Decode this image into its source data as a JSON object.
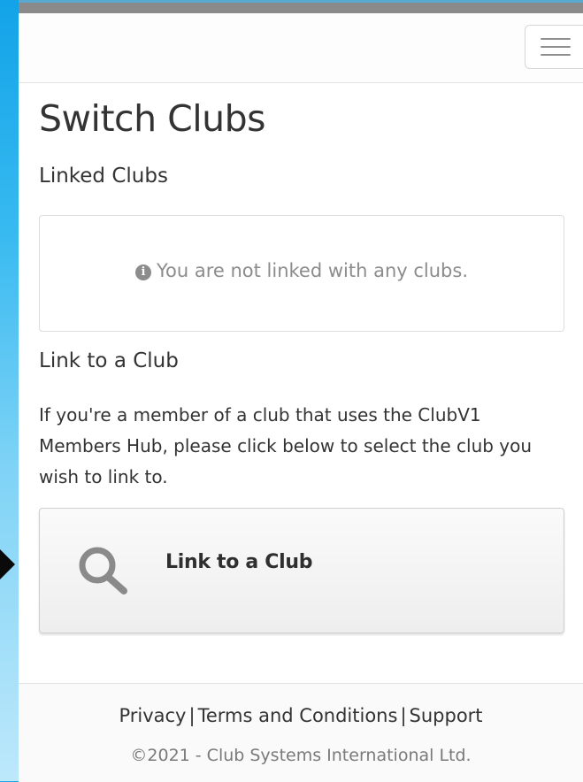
{
  "header": {
    "menu_icon": "hamburger-menu-icon"
  },
  "page": {
    "title": "Switch Clubs"
  },
  "linked_clubs": {
    "heading": "Linked Clubs",
    "empty_icon": "info-circle-icon",
    "empty_message": "You are not linked with any clubs."
  },
  "link_section": {
    "heading": "Link to a Club",
    "description": "If you're a member of a club that uses the ClubV1 Members Hub, please click below to select the club you wish to link to.",
    "button_icon": "search-icon",
    "button_label": "Link to a Club"
  },
  "footer": {
    "privacy": "Privacy",
    "terms": "Terms and Conditions",
    "support": "Support",
    "separator": "|",
    "copyright": "©2021 - Club Systems International Ltd."
  },
  "colors": {
    "accent_top": "#5aa9d0",
    "topbar": "#8a8a8a",
    "background_blue": "#1aa7e6"
  }
}
